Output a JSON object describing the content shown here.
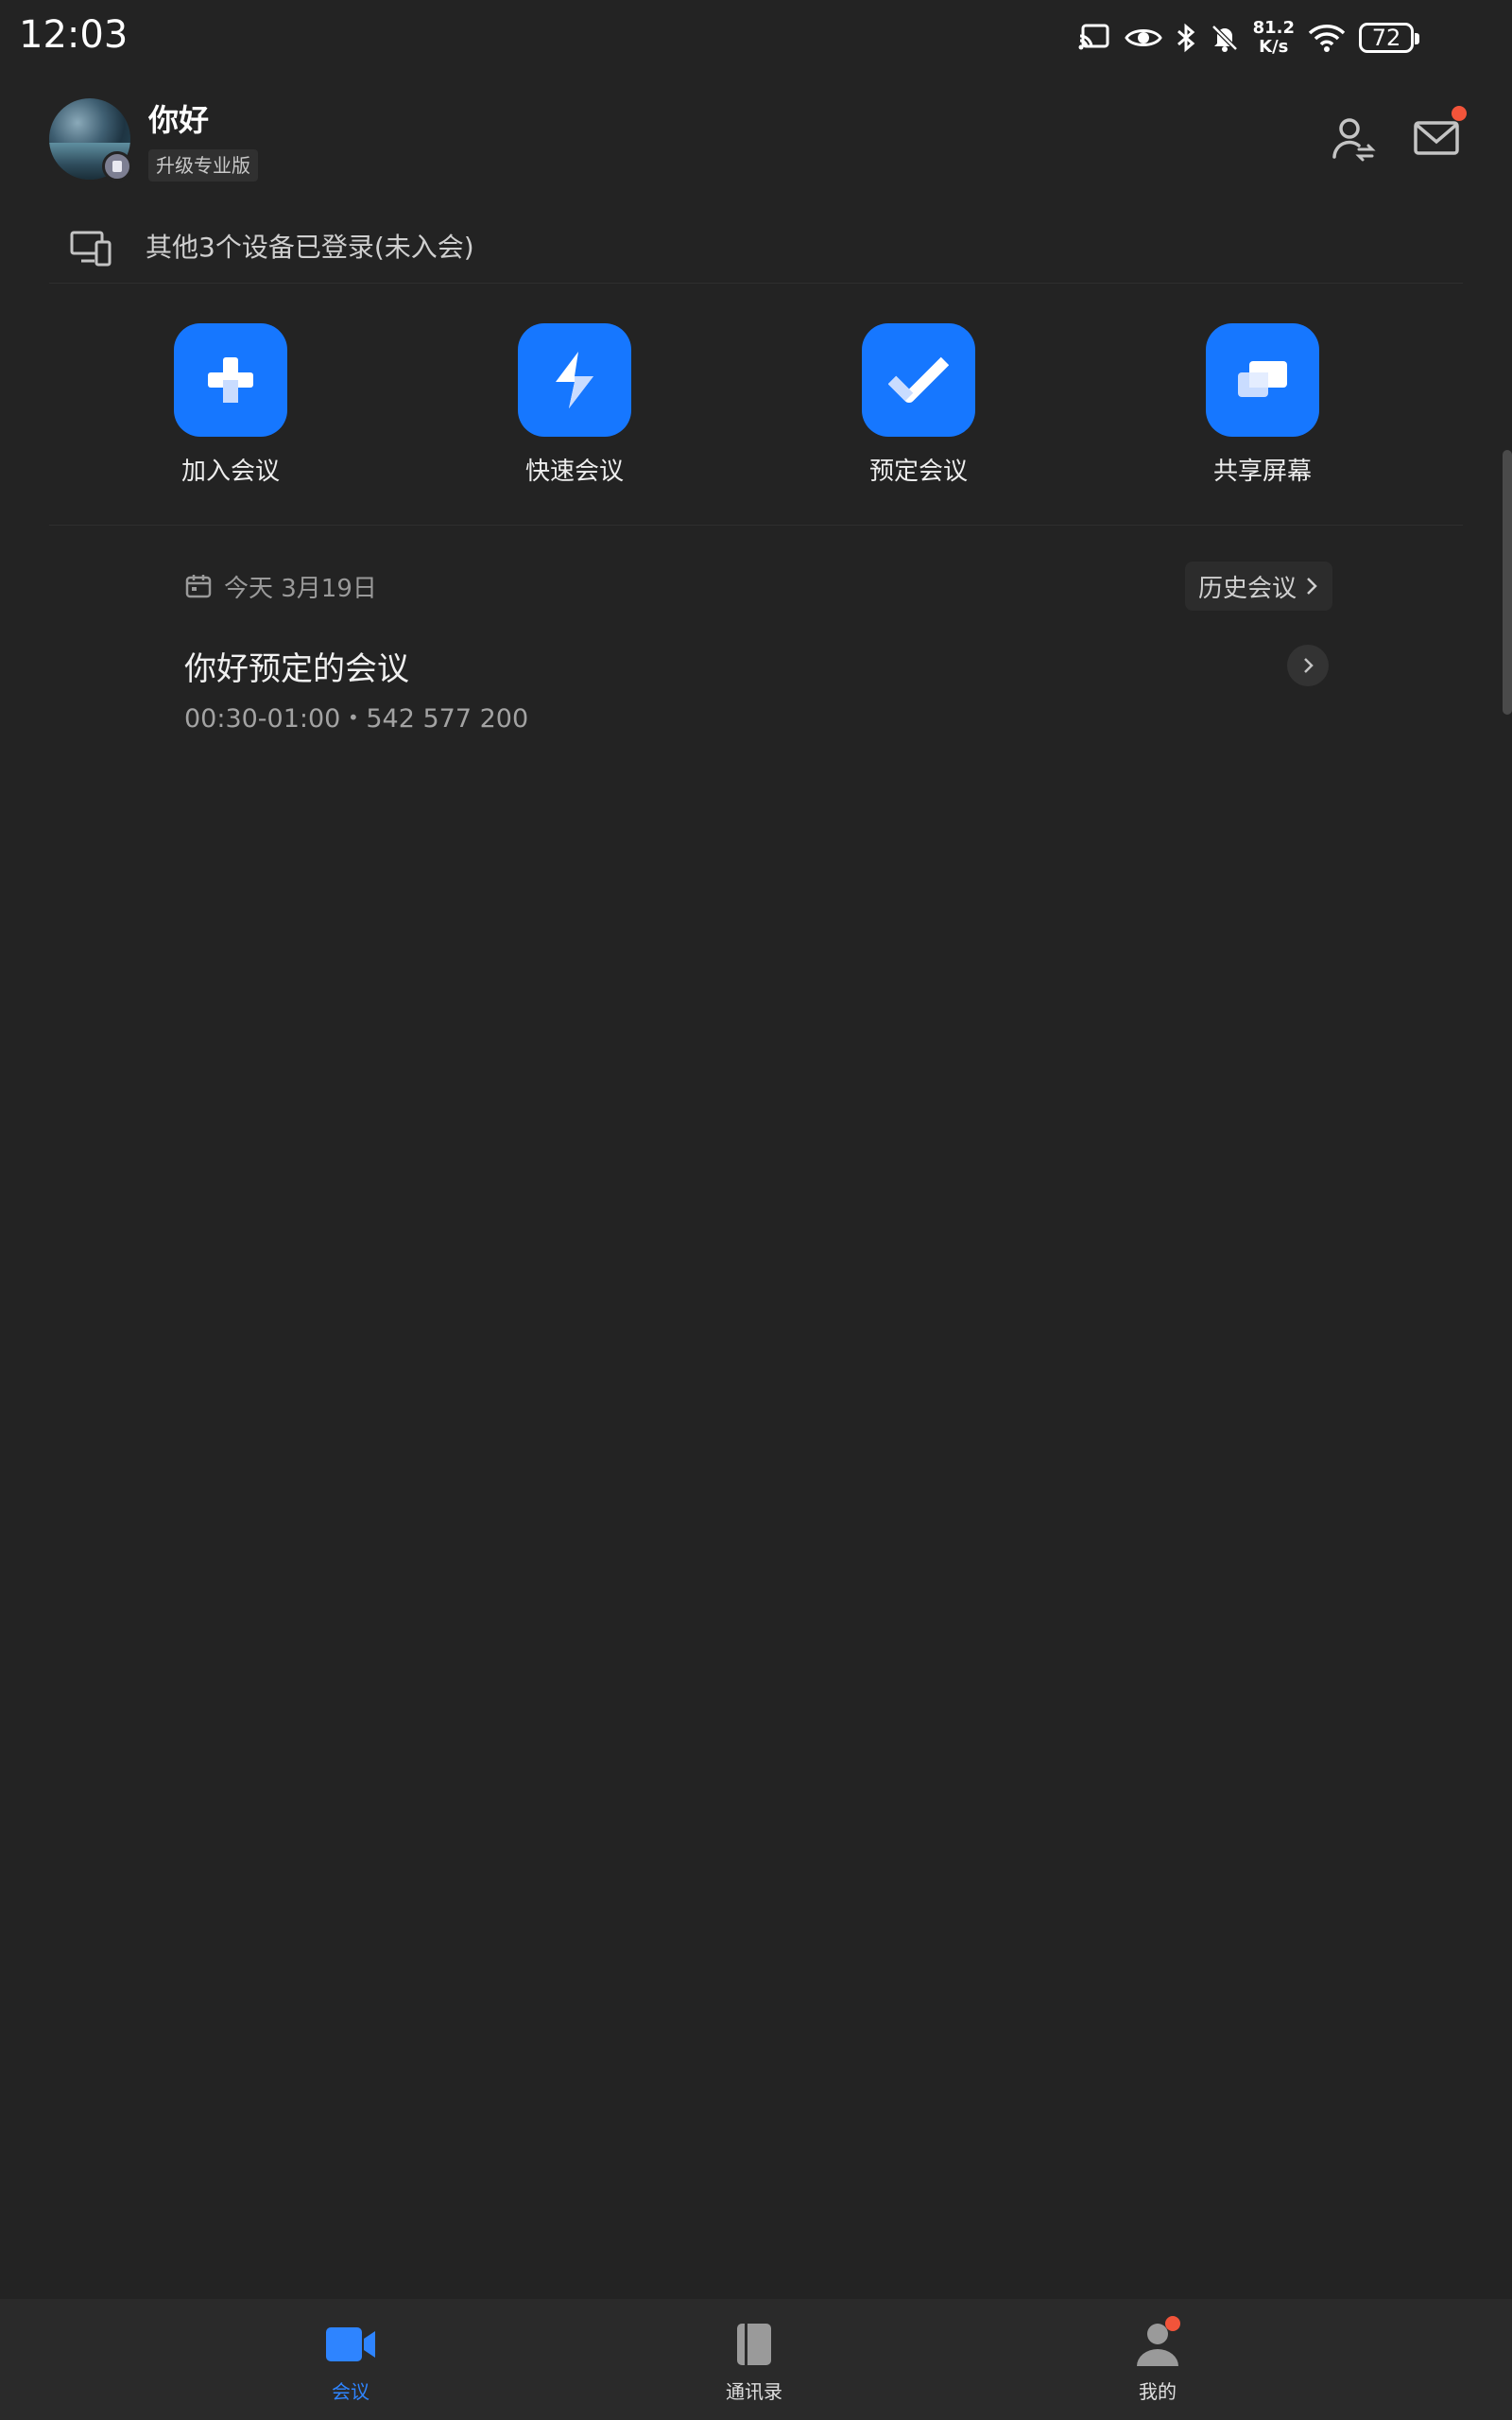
{
  "status_bar": {
    "time": "12:03",
    "net_speed_value": "81.2",
    "net_speed_unit": "K/s",
    "battery": "72",
    "icons": [
      "cast-icon",
      "eye-icon",
      "bluetooth-icon",
      "mute-icon",
      "wifi-icon",
      "battery-icon"
    ]
  },
  "header": {
    "user_name": "你好",
    "upgrade_label": "升级专业版",
    "icons": [
      "contacts-switch-icon",
      "mail-icon"
    ],
    "mail_has_notification": true
  },
  "devices_notice": {
    "text": "其他3个设备已登录(未入会)",
    "icon": "devices-icon"
  },
  "quick_actions": [
    {
      "label": "加入会议",
      "icon": "plus-icon"
    },
    {
      "label": "快速会议",
      "icon": "lightning-icon"
    },
    {
      "label": "预定会议",
      "icon": "check-icon"
    },
    {
      "label": "共享屏幕",
      "icon": "share-screen-icon"
    }
  ],
  "schedule": {
    "date_label": "今天 3月19日",
    "history_label": "历史会议",
    "meetings": [
      {
        "title": "你好预定的会议",
        "meta": "00:30-01:00・542 577 200"
      }
    ]
  },
  "bottom_nav": [
    {
      "label": "会议",
      "icon": "video-icon",
      "active": true
    },
    {
      "label": "通讯录",
      "icon": "contacts-book-icon",
      "active": false
    },
    {
      "label": "我的",
      "icon": "person-icon",
      "active": false,
      "badge": true
    }
  ],
  "colors": {
    "background": "#232323",
    "accent": "#1677ff",
    "nav_active": "#2e84ff",
    "notification": "#f2543a"
  }
}
